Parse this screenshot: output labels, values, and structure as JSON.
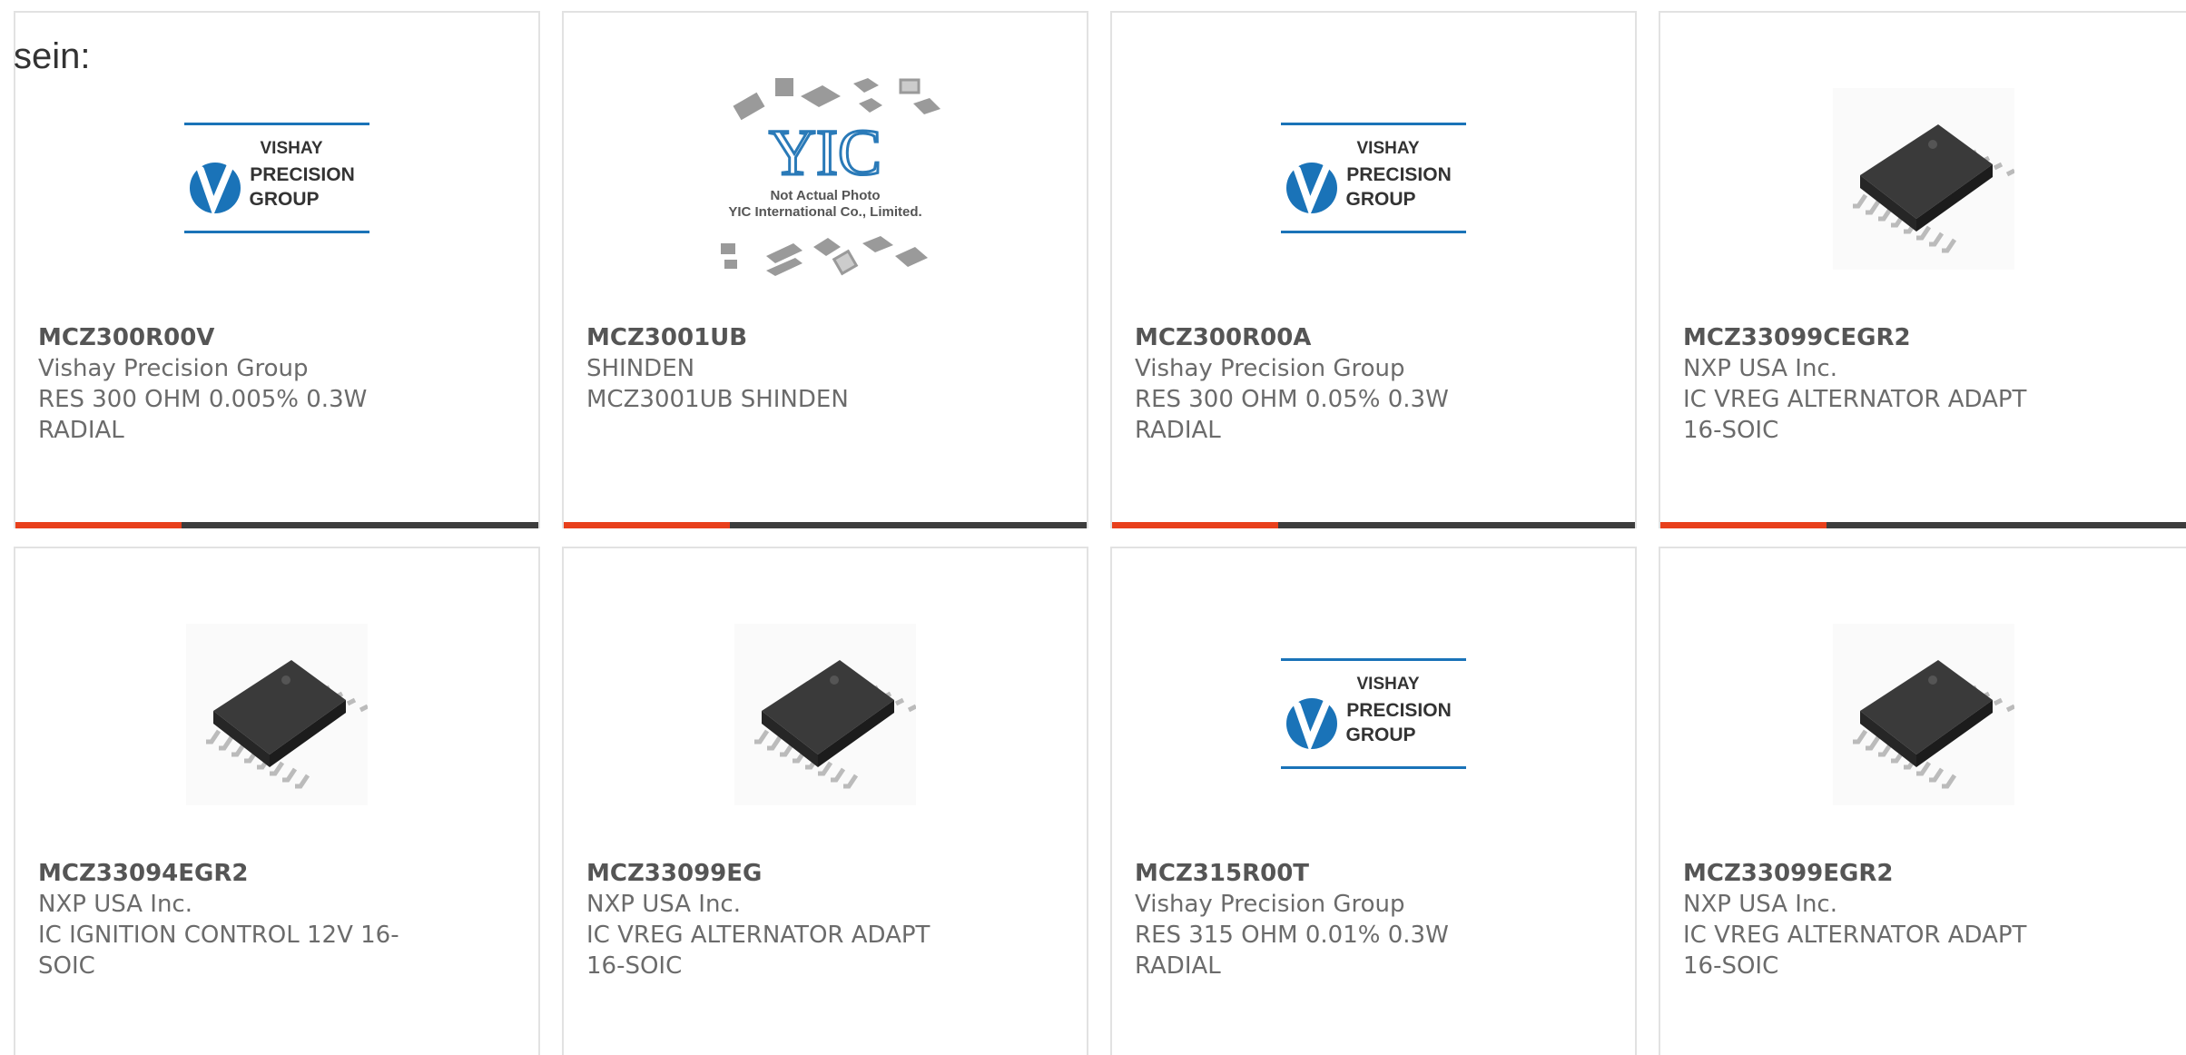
{
  "intro_text": "sein:",
  "brand_colors": {
    "accent": "#e8401c",
    "bar": "#3d3d3d",
    "vishay_blue": "#1a73b8"
  },
  "products": [
    {
      "part_number": "MCZ300R00V",
      "manufacturer": "Vishay Precision Group",
      "description": "RES 300 OHM 0.005% 0.3W RADIAL",
      "image": "vishay-logo"
    },
    {
      "part_number": "MCZ3001UB",
      "manufacturer": "SHINDEN",
      "description": "MCZ3001UB SHINDEN",
      "image": "yic-not-actual-photo",
      "image_caption": [
        "Not Actual Photo",
        "YIC International Co., Limited."
      ]
    },
    {
      "part_number": "MCZ300R00A",
      "manufacturer": "Vishay Precision Group",
      "description": "RES 300 OHM 0.05% 0.3W RADIAL",
      "image": "vishay-logo"
    },
    {
      "part_number": "MCZ33099CEGR2",
      "manufacturer": "NXP USA Inc.",
      "description": "IC VREG ALTERNATOR ADAPT 16-SOIC",
      "image": "soic-chip"
    },
    {
      "part_number": "MCZ33094EGR2",
      "manufacturer": "NXP USA Inc.",
      "description": "IC IGNITION CONTROL 12V 16-SOIC",
      "image": "soic-chip"
    },
    {
      "part_number": "MCZ33099EG",
      "manufacturer": "NXP USA Inc.",
      "description": "IC VREG ALTERNATOR ADAPT 16-SOIC",
      "image": "soic-chip"
    },
    {
      "part_number": "MCZ315R00T",
      "manufacturer": "Vishay Precision Group",
      "description": "RES 315 OHM 0.01% 0.3W RADIAL",
      "image": "vishay-logo"
    },
    {
      "part_number": "MCZ33099EGR2",
      "manufacturer": "NXP USA Inc.",
      "description": "IC VREG ALTERNATOR ADAPT 16-SOIC",
      "image": "soic-chip"
    }
  ],
  "vishay_logo_text": [
    "VISHAY",
    "PRECISION",
    "GROUP"
  ]
}
